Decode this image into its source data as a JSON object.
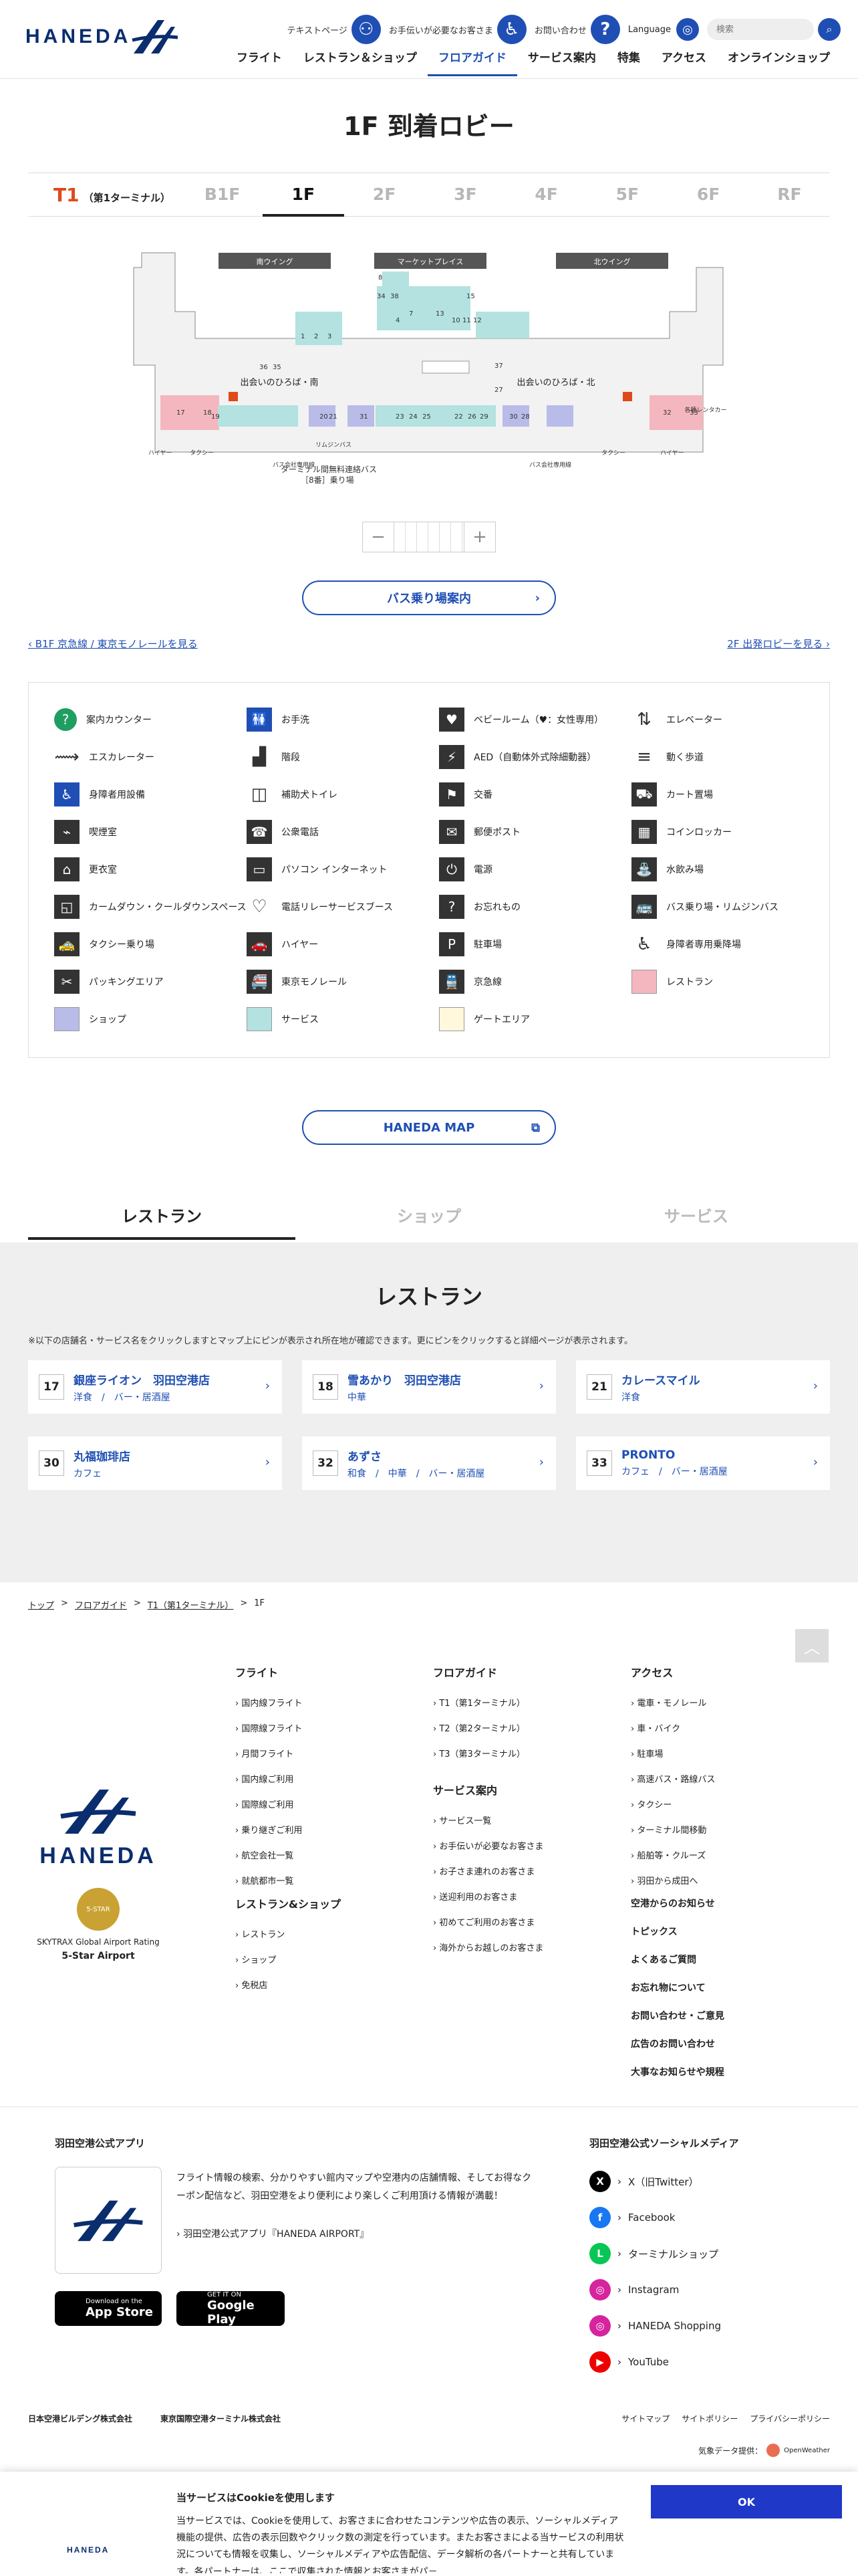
{
  "colors": {
    "accent": "#1f4fb4",
    "t1": "#e04a1a",
    "restaurant": "#f5b7bf",
    "shop": "#b9bce8",
    "service": "#b3e2e0",
    "gate": "#fff8dc"
  },
  "header": {
    "logo": "HANEDA",
    "util": [
      {
        "label": "テキストページ",
        "icon": "accessibility-icon"
      },
      {
        "label": "お手伝いが必要なお客さま",
        "icon": "wheelchair-icon"
      },
      {
        "label": "お問い合わせ",
        "icon": "question-icon"
      }
    ],
    "language": "Language",
    "search_placeholder": "検索",
    "nav": [
      "フライト",
      "レストラン＆ショップ",
      "フロアガイド",
      "サービス案内",
      "特集",
      "アクセス",
      "オンラインショップ"
    ]
  },
  "page": {
    "title": "1F 到着ロビー"
  },
  "terminal": {
    "code": "T1",
    "name": "（第1ターミナル）"
  },
  "floors": [
    "B1F",
    "1F",
    "2F",
    "3F",
    "4F",
    "5F",
    "6F",
    "RF"
  ],
  "map": {
    "wings": [
      "南ウイング",
      "マーケットプレイス",
      "北ウイング"
    ],
    "south_meeting": "出会いのひろば・南",
    "north_meeting": "出会いのひろば・北",
    "bus_label": "ターミナル間無料連絡バス",
    "bus_stop": "［8番］乗り場",
    "bus_south": "バス会社専用線",
    "bus_north": "バス会社専用線",
    "hire": "ハイヤー",
    "taxi": "タクシー",
    "limousine": "リムジンバス",
    "rental": "各種レンタカー",
    "numbers": [
      "8",
      "34",
      "38",
      "7",
      "15",
      "13",
      "4",
      "10",
      "11",
      "12",
      "1",
      "2",
      "3",
      "37",
      "27",
      "17",
      "18",
      "19",
      "30",
      "32",
      "33",
      "22",
      "26",
      "20",
      "21",
      "29",
      "28",
      "23",
      "24",
      "25",
      "31",
      "36",
      "35"
    ]
  },
  "bus_button": "バス乗り場案内",
  "link_left": "B1F 京急線 / 東京モノレールを見る",
  "link_right": "2F 出発ロビーを見る",
  "legend": [
    {
      "label": "案内カウンター",
      "icon": "info-icon"
    },
    {
      "label": "お手洗",
      "icon": "restroom-icon"
    },
    {
      "label": "ベビールーム（♥：女性専用）",
      "icon": "baby-room-icon"
    },
    {
      "label": "エレベーター",
      "icon": "elevator-icon"
    },
    {
      "label": "エスカレーター",
      "icon": "escalator-icon"
    },
    {
      "label": "階段",
      "icon": "stairs-icon"
    },
    {
      "label": "AED（自動体外式除細動器）",
      "icon": "aed-icon"
    },
    {
      "label": "動く歩道",
      "icon": "moving-walkway-icon"
    },
    {
      "label": "身障者用設備",
      "icon": "wheelchair-icon"
    },
    {
      "label": "補助犬トイレ",
      "icon": "dog-toilet-icon"
    },
    {
      "label": "交番",
      "icon": "police-icon"
    },
    {
      "label": "カート置場",
      "icon": "cart-icon"
    },
    {
      "label": "喫煙室",
      "icon": "smoking-icon"
    },
    {
      "label": "公衆電話",
      "icon": "phone-icon"
    },
    {
      "label": "郵便ポスト",
      "icon": "mailbox-icon"
    },
    {
      "label": "コインロッカー",
      "icon": "locker-icon"
    },
    {
      "label": "更衣室",
      "icon": "changing-room-icon"
    },
    {
      "label": "パソコン インターネット",
      "icon": "computer-icon"
    },
    {
      "label": "電源",
      "icon": "power-icon"
    },
    {
      "label": "水飲み場",
      "icon": "water-fountain-icon"
    },
    {
      "label": "カームダウン・クールダウンスペース",
      "icon": "calm-down-icon"
    },
    {
      "label": "電話リレーサービスブース",
      "icon": "relay-service-icon"
    },
    {
      "label": "お忘れもの",
      "icon": "lost-item-icon"
    },
    {
      "label": "バス乗り場・リムジンバス",
      "icon": "bus-icon"
    },
    {
      "label": "タクシー乗り場",
      "icon": "taxi-icon"
    },
    {
      "label": "ハイヤー",
      "icon": "hire-car-icon"
    },
    {
      "label": "駐車場",
      "icon": "parking-icon"
    },
    {
      "label": "身障者専用乗降場",
      "icon": "accessible-boarding-icon"
    },
    {
      "label": "パッキングエリア",
      "icon": "packing-icon"
    },
    {
      "label": "東京モノレール",
      "icon": "monorail-icon"
    },
    {
      "label": "京急線",
      "icon": "train-icon"
    },
    {
      "label": "レストラン",
      "icon": "restaurant-swatch"
    },
    {
      "label": "ショップ",
      "icon": "shop-swatch"
    },
    {
      "label": "サービス",
      "icon": "service-swatch"
    },
    {
      "label": "ゲートエリア",
      "icon": "gate-swatch"
    }
  ],
  "haneda_map_button": "HANEDA MAP",
  "category_tabs": [
    "レストラン",
    "ショップ",
    "サービス"
  ],
  "restaurant": {
    "title": "レストラン",
    "note": "※以下の店舗名・サービス名をクリックしますとマップ上にピンが表示され所在地が確認できます。更にピンをクリックすると詳細ページが表示されます。",
    "items": [
      {
        "num": "17",
        "name": "銀座ライオン　羽田空港店",
        "cat": "洋食　/　バー・居酒屋"
      },
      {
        "num": "18",
        "name": "雪あかり　羽田空港店",
        "cat": "中華"
      },
      {
        "num": "21",
        "name": "カレースマイル",
        "cat": "洋食"
      },
      {
        "num": "30",
        "name": "丸福珈琲店",
        "cat": "カフェ"
      },
      {
        "num": "32",
        "name": "あずさ",
        "cat": "和食　/　中華　/　バー・居酒屋"
      },
      {
        "num": "33",
        "name": "PRONTO",
        "cat": "カフェ　/　バー・居酒屋"
      }
    ]
  },
  "breadcrumb": [
    "トップ",
    "フロアガイド",
    "T1（第1ターミナル）",
    "1F"
  ],
  "footer": {
    "brand": "HANEDA",
    "medal": "5-STAR",
    "rating1": "SKYTRAX Global Airport Rating",
    "rating2": "5-Star Airport",
    "flight": {
      "title": "フライト",
      "items": [
        "国内線フライト",
        "国際線フライト",
        "月間フライト",
        "国内線ご利用",
        "国際線ご利用",
        "乗り継ぎご利用",
        "航空会社一覧",
        "就航都市一覧"
      ]
    },
    "shop": {
      "title": "レストラン&ショップ",
      "items": [
        "レストラン",
        "ショップ",
        "免税店"
      ]
    },
    "floor": {
      "title": "フロアガイド",
      "items": [
        "T1（第1ターミナル）",
        "T2（第2ターミナル）",
        "T3（第3ターミナル）"
      ]
    },
    "service": {
      "title": "サービス案内",
      "items": [
        "サービス一覧",
        "お手伝いが必要なお客さま",
        "お子さま連れのお客さま",
        "送迎利用のお客さま",
        "初めてご利用のお客さま",
        "海外からお越しのお客さま"
      ]
    },
    "access": {
      "title": "アクセス",
      "items": [
        "電車・モノレール",
        "車・バイク",
        "駐車場",
        "高速バス・路線バス",
        "タクシー",
        "ターミナル間移動",
        "船舶等・クルーズ",
        "羽田から成田へ"
      ]
    },
    "bold_links": [
      "空港からのお知らせ",
      "トピックス",
      "よくあるご質問",
      "お忘れ物について",
      "お問い合わせ・ご意見",
      "広告のお問い合わせ",
      "大事なお知らせや規程"
    ],
    "app_title": "羽田空港公式アプリ",
    "app_text": "フライト情報の検索、分かりやすい館内マップや空港内の店舗情報、そしてお得なクーポン配信など、羽田空港をより便利により楽しくご利用頂ける情報が満載！",
    "app_link": "羽田空港公式アプリ『HANEDA AIRPORT』",
    "appstore_top": "Download on the",
    "appstore": "App Store",
    "gplay_top": "GET IT ON",
    "gplay": "Google Play",
    "social_title": "羽田空港公式ソーシャルメディア",
    "social": [
      "X（旧Twitter）",
      "Facebook",
      "ターミナルショップ",
      "Instagram",
      "HANEDA Shopping",
      "YouTube"
    ],
    "corp1": "日本空港ビルデング株式会社",
    "corp2": "東京国際空港ターミナル株式会社",
    "legal": [
      "サイトマップ",
      "サイトポリシー",
      "プライバシーポリシー"
    ],
    "weather": "気象データ提供：",
    "weather_brand": "OpenWeather"
  },
  "cookie": {
    "title": "当サービスはCookieを使用します",
    "body": "当サービスでは、Cookieを使用して、お客さまに合わせたコンテンツや広告の表示、ソーシャルメディア機能の提供、広告の表示回数やクリック数の測定を行っています。またお客さまによる当サービスの利用状況についても情報を収集し、ソーシャルメディアや広告配信、データ解析の各パートナーと共有しています。各パートナーは、ここで収集された情報とお客さまがパ－",
    "ok": "OK",
    "logo": "HANEDA"
  }
}
